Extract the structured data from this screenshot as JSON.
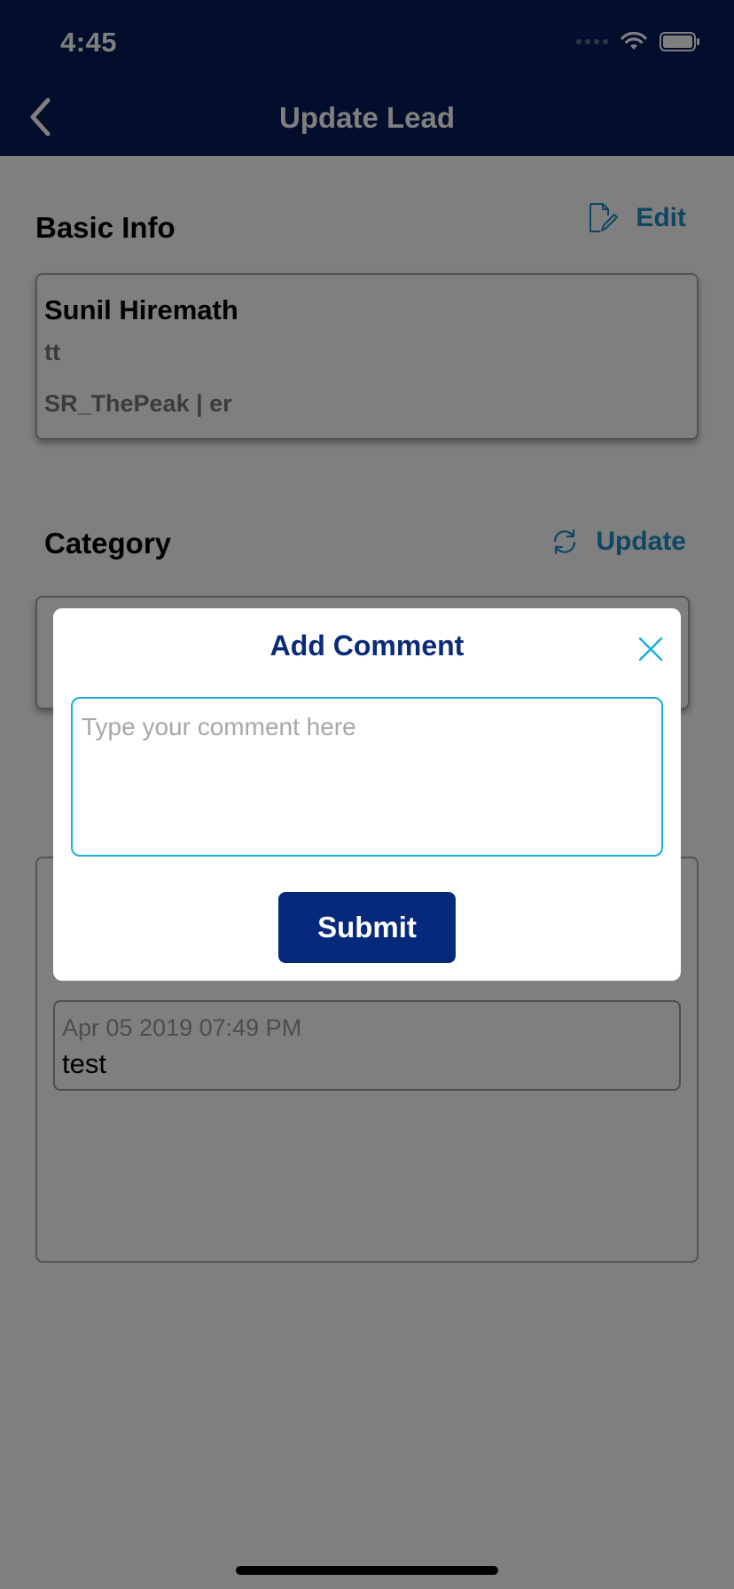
{
  "status_bar": {
    "time": "4:45"
  },
  "nav": {
    "title": "Update Lead",
    "back_icon": "chevron-left-icon"
  },
  "basic_info": {
    "title": "Basic Info",
    "edit_label": "Edit",
    "name": "Sunil Hiremath",
    "subtitle": "tt",
    "detail": "SR_ThePeak | er"
  },
  "category": {
    "title": "Category",
    "update_label": "Update"
  },
  "comments": {
    "items": [
      {
        "date": "Apr 05 2019 07:49 PM",
        "text": "test"
      }
    ]
  },
  "modal": {
    "title": "Add Comment",
    "placeholder": "Type your comment here",
    "submit_label": "Submit"
  },
  "colors": {
    "nav_bg": "#061a58",
    "accent_link": "#1a8fc4",
    "modal_title": "#0a2a7a",
    "submit_bg": "#06297c",
    "field_border": "#19b0dc"
  }
}
